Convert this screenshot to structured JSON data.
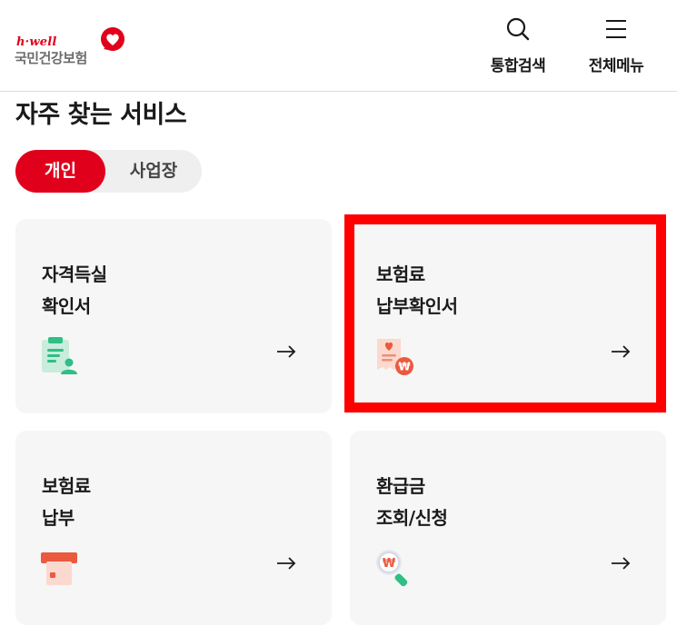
{
  "header": {
    "logo": {
      "tagline": "h·well",
      "org_name": "국민건강보험",
      "icon": "heart-logo-icon"
    },
    "search_label": "통합검색",
    "menu_label": "전체메뉴"
  },
  "section": {
    "title": "자주 찾는 서비스"
  },
  "segment": {
    "items": [
      {
        "label": "개인",
        "selected": true
      },
      {
        "label": "사업장",
        "selected": false
      }
    ]
  },
  "cards": [
    {
      "line1": "자격득실",
      "line2": "확인서",
      "icon": "qualification-certificate-icon",
      "arrow": "→",
      "highlighted": false
    },
    {
      "line1": "보험료",
      "line2": "납부확인서",
      "icon": "payment-receipt-icon",
      "arrow": "→",
      "highlighted": true
    },
    {
      "line1": "보험료",
      "line2": "납부",
      "icon": "card-payment-icon",
      "arrow": "→",
      "highlighted": false
    },
    {
      "line1": "환급금",
      "line2": "조회/신청",
      "icon": "refund-search-icon",
      "arrow": "→",
      "highlighted": false
    }
  ],
  "colors": {
    "brand_red": "#e1001b",
    "highlight_red": "#ff0000",
    "card_bg": "#f6f6f6",
    "segment_bg": "#efefef"
  }
}
